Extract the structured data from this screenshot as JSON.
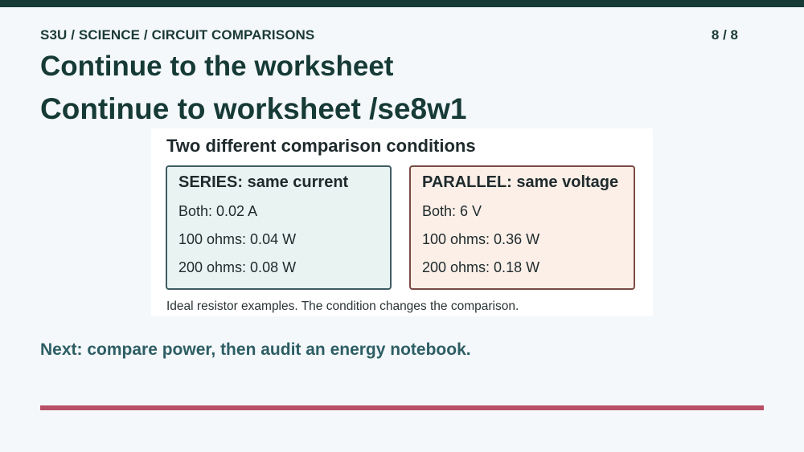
{
  "header": {
    "breadcrumb": "S3U / SCIENCE / CIRCUIT COMPARISONS",
    "page_counter": "8 / 8",
    "title": "Continue to the worksheet",
    "subtitle": "Continue to worksheet /se8w1"
  },
  "panel": {
    "heading": "Two different comparison conditions",
    "cards": [
      {
        "title": "SERIES: same current",
        "lines": [
          "Both: 0.02 A",
          "100 ohms: 0.04 W",
          "200 ohms: 0.08 W"
        ]
      },
      {
        "title": "PARALLEL: same voltage",
        "lines": [
          "Both: 6 V",
          "100 ohms: 0.36 W",
          "200 ohms: 0.18 W"
        ]
      }
    ],
    "caption": "Ideal resistor examples. The condition changes the comparison."
  },
  "footer": {
    "next_text": "Next: compare power, then audit an energy notebook."
  },
  "colors": {
    "top_bar": "#163a36",
    "heading_text": "#163a36",
    "next_text": "#2d5e64",
    "accent_bar": "#b94f66",
    "series_fill": "#e8f3f2",
    "series_border": "#3f5c63",
    "parallel_fill": "#fbefe8",
    "parallel_border": "#7a4a44"
  }
}
